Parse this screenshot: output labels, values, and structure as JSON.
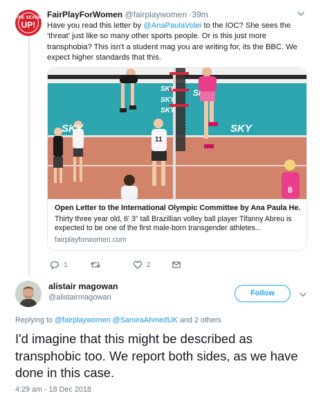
{
  "parent_tweet": {
    "avatar_text_small": "THE SEVEN",
    "avatar_text_big": "UP!",
    "name": "FairPlayForWomen",
    "handle": "@fairplaywomen",
    "separator": "·",
    "time": "39m",
    "text": {
      "part1": "Have you read this letter by ",
      "mention": "@AnaPaulaVolei",
      "part2": " to the IOC? She sees the 'threat' just like so many other sports people. Or is this just more transphobia? This isn't a student mag you are writing for, its the BBC. We expect higher standards that this."
    },
    "card": {
      "image_texts": [
        "SKY",
        "SKY",
        "SKY",
        "SKY",
        "SKY",
        "SKY",
        "11",
        "8"
      ],
      "title": "Open Letter to the International Olympic Committee by Ana Paula He...",
      "description": "Thirty three year old, 6' 3\" tall Brazillian volley ball player Tifanny Abreu is expected to be one of the first male-born transgender athletes...",
      "domain": "fairplayforwomen.com"
    },
    "actions": {
      "reply_count": "1",
      "retweet_count": "",
      "like_count": "2"
    }
  },
  "main_tweet": {
    "name": "alistair magowan",
    "handle": "@alistairmagowan",
    "follow_label": "Follow",
    "replying": {
      "prefix": "Replying to ",
      "mention1": "@fairplaywomen",
      "mention2": "@SamiraAhmedUK",
      "suffix": " and 2 others"
    },
    "text": "I'd imagine that this might be described as transphobic too. We report both sides, as we have done in this case.",
    "timestamp": "4:29 am - 18 Dec 2018"
  },
  "colors": {
    "link": "#1b95e0",
    "muted": "#657786",
    "follow": "#1da1f2",
    "thread_line": "#cfe8f6",
    "avatar_red": "#d6212c"
  },
  "icons": [
    "chevron-down-icon",
    "reply-icon",
    "retweet-icon",
    "like-icon",
    "dm-icon"
  ]
}
